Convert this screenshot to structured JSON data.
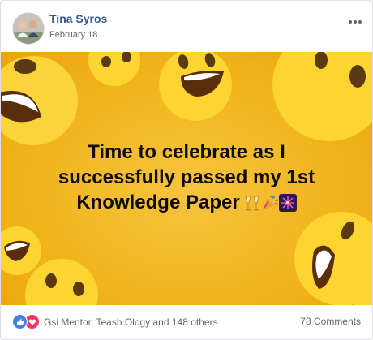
{
  "post": {
    "author": "Tina Syros",
    "date": "February 18",
    "more_icon": "ellipsis-icon",
    "image": {
      "caption_lines": [
        "Time to celebrate as I",
        "successfully passed my 1st",
        "Knowledge Paper"
      ],
      "caption_emojis": [
        "champagne-glasses-icon",
        "party-popper-icon",
        "fireworks-icon"
      ],
      "background_color": "#f2b51e",
      "emoji_color": "#fcd531"
    },
    "footer": {
      "reaction_icons": [
        "like-icon",
        "love-icon"
      ],
      "reactors_text": "Gsi Mentor, Teash Ology and 148 others",
      "comments_text": "78 Comments"
    }
  },
  "colors": {
    "author_link": "#385898",
    "meta_text": "#616770",
    "like": "#4a7fe0",
    "love": "#f0375f"
  }
}
